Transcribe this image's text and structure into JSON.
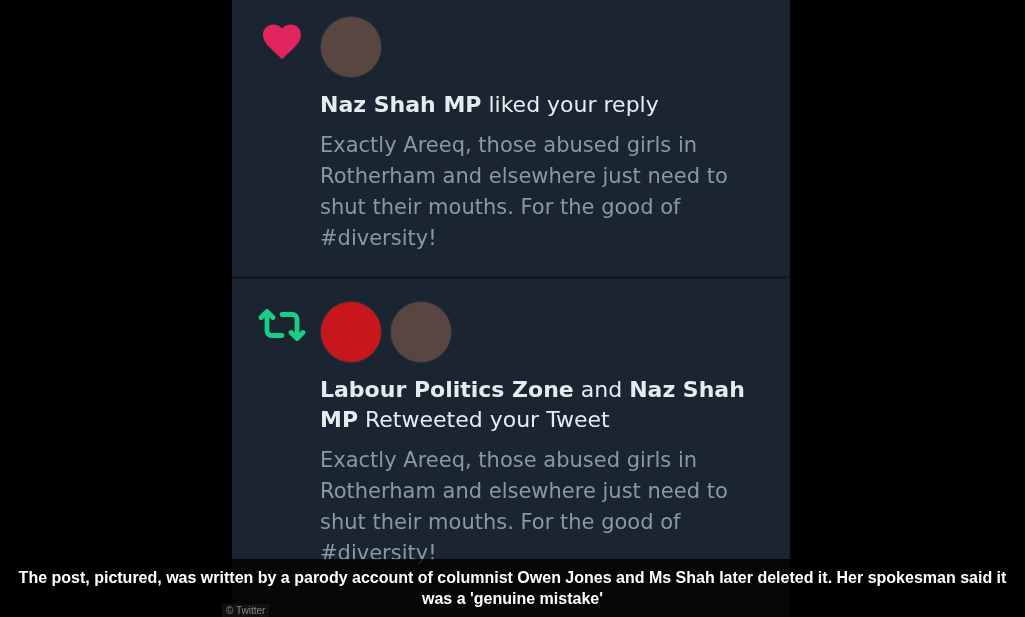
{
  "notifications": [
    {
      "kind": "like",
      "actors": [
        {
          "kind": "person"
        }
      ],
      "headline": "**Naz Shah MP** liked your reply",
      "tweet": "Exactly Areeq, those abused girls in Rotherham and elsewhere just need to shut their mouths. For the good of #diversity!"
    },
    {
      "kind": "retweet",
      "actors": [
        {
          "kind": "logo"
        },
        {
          "kind": "person"
        }
      ],
      "headline": "**Labour Politics Zone** and **Naz Shah MP** Retweeted your Tweet",
      "tweet": "Exactly Areeq, those abused girls in Rotherham and elsewhere just need to shut their mouths. For the good of #diversity!"
    }
  ],
  "credit": "© Twitter",
  "caption": "The post, pictured, was written by a parody account of columnist Owen Jones and Ms Shah later deleted it. Her spokesman said it was a 'genuine mistake'"
}
